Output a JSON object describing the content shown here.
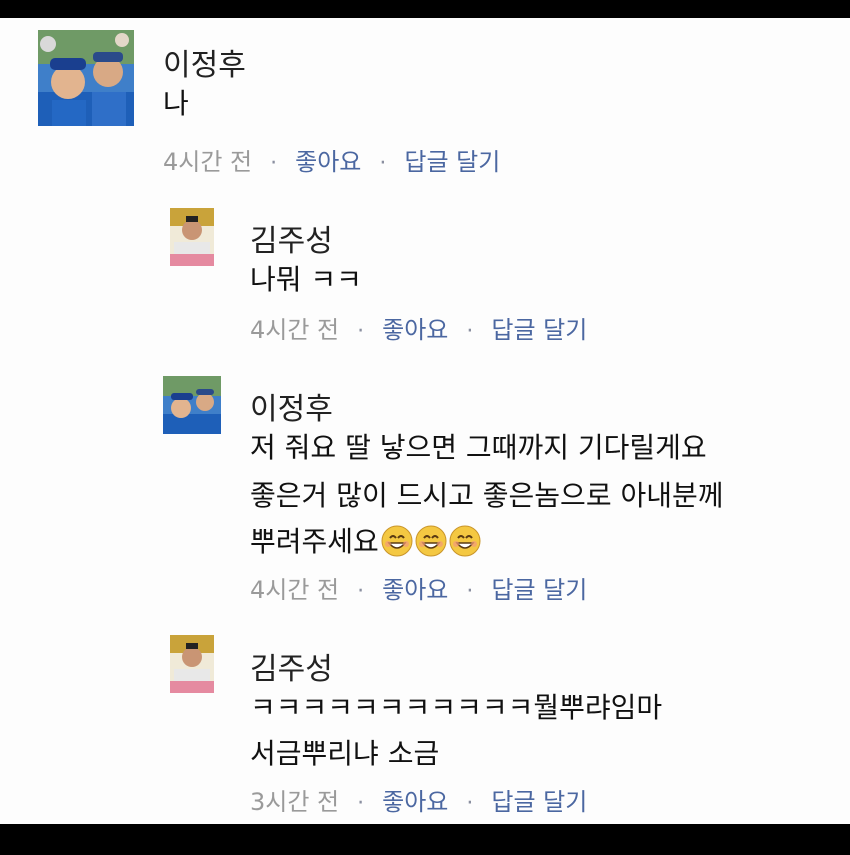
{
  "comments": [
    {
      "author": "이정후",
      "lines": [
        "나"
      ],
      "time": "4시간 전",
      "like": "좋아요",
      "reply": "답글 달기"
    },
    {
      "author": "김주성",
      "lines": [
        "나뭐 ㅋㅋ"
      ],
      "time": "4시간 전",
      "like": "좋아요",
      "reply": "답글 달기"
    },
    {
      "author": "이정후",
      "lines": [
        "저 줘요 딸 낳으면 그때까지 기다릴게요",
        "좋은거 많이 드시고 좋은놈으로 아내분께",
        "뿌려주세요"
      ],
      "time": "4시간 전",
      "like": "좋아요",
      "reply": "답글 달기"
    },
    {
      "author": "김주성",
      "lines": [
        "ㅋㅋㅋㅋㅋㅋㅋㅋㅋㅋㅋ뭘뿌랴임마",
        "서금뿌리냐 소금"
      ],
      "time": "3시간 전",
      "like": "좋아요",
      "reply": "답글 달기"
    }
  ],
  "colors": {
    "link": "#4b67a1",
    "meta": "#9a9a9a",
    "text": "#111111"
  },
  "icons": {
    "emoji": "smiling-face-icon"
  }
}
